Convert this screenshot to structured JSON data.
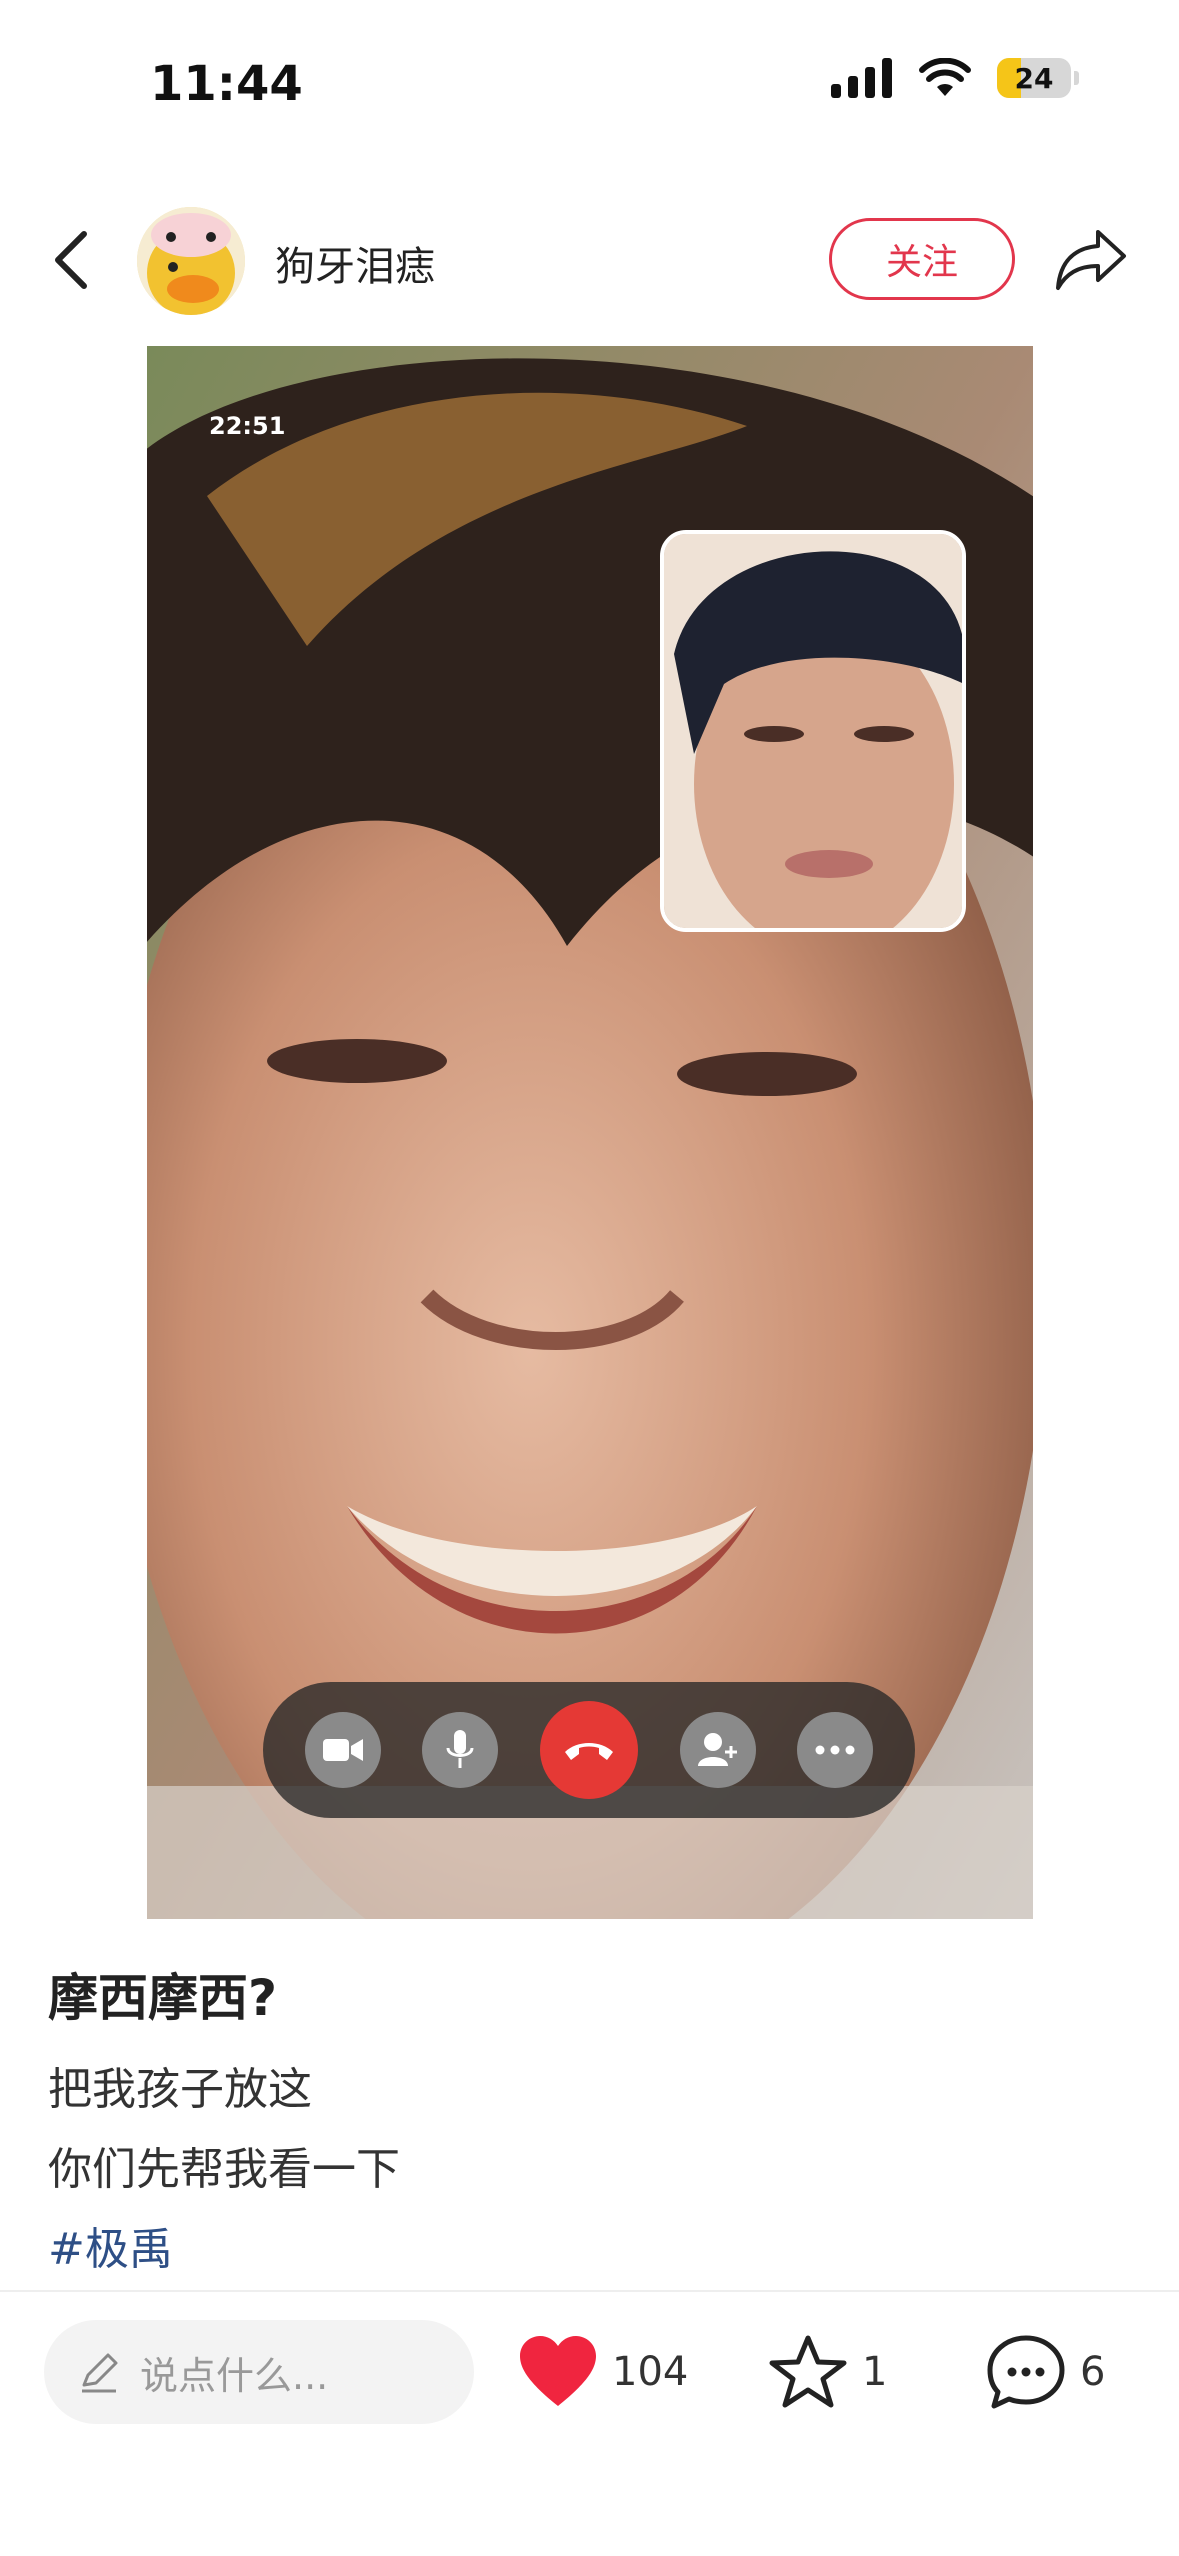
{
  "status_bar": {
    "time": "11:44",
    "battery": "24"
  },
  "header": {
    "username": "狗牙泪痣",
    "follow_label": "关注"
  },
  "video": {
    "timestamp": "22:51"
  },
  "post": {
    "title": "摩西摩西?",
    "lines": [
      "把我孩子放这",
      "你们先帮我看一下"
    ],
    "hashtag": "#极禹"
  },
  "bottom_bar": {
    "comment_placeholder": "说点什么...",
    "likes": "104",
    "favorites": "1",
    "comments": "6"
  },
  "colors": {
    "accent": "#e2364c",
    "hashtag": "#2e4f86",
    "like": "#f0253f"
  }
}
